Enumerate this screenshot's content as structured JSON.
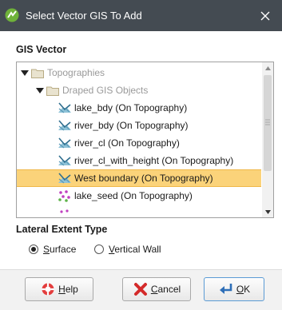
{
  "window": {
    "title": "Select Vector GIS To Add"
  },
  "gis_section": {
    "label": "GIS Vector"
  },
  "tree": {
    "rows": [
      {
        "label": "Topographies",
        "level": 0,
        "type": "folder",
        "expanded": true,
        "disabled": true,
        "selected": false
      },
      {
        "label": "Draped GIS Objects",
        "level": 1,
        "type": "folder",
        "expanded": true,
        "disabled": true,
        "selected": false
      },
      {
        "label": "lake_bdy (On Topography)",
        "level": 2,
        "type": "lines",
        "selected": false
      },
      {
        "label": "river_bdy (On Topography)",
        "level": 2,
        "type": "lines",
        "selected": false
      },
      {
        "label": "river_cl (On Topography)",
        "level": 2,
        "type": "lines",
        "selected": false
      },
      {
        "label": "river_cl_with_height (On Topography)",
        "level": 2,
        "type": "lines",
        "selected": false
      },
      {
        "label": "West boundary (On Topography)",
        "level": 2,
        "type": "lines",
        "selected": true
      },
      {
        "label": "lake_seed (On Topography)",
        "level": 2,
        "type": "points",
        "selected": false
      }
    ]
  },
  "lateral_section": {
    "label": "Lateral Extent Type",
    "options": [
      {
        "accel": "S",
        "rest": "urface",
        "checked": true
      },
      {
        "accel": "V",
        "rest": "ertical Wall",
        "checked": false
      }
    ]
  },
  "buttons": {
    "help": {
      "accel": "H",
      "rest": "elp"
    },
    "cancel": {
      "accel": "C",
      "rest": "ancel"
    },
    "ok": {
      "accel": "O",
      "rest": "K"
    }
  },
  "colors": {
    "titlebar": "#444b52",
    "selection": "#fbd37a",
    "ok_border": "#5b9bd5"
  }
}
